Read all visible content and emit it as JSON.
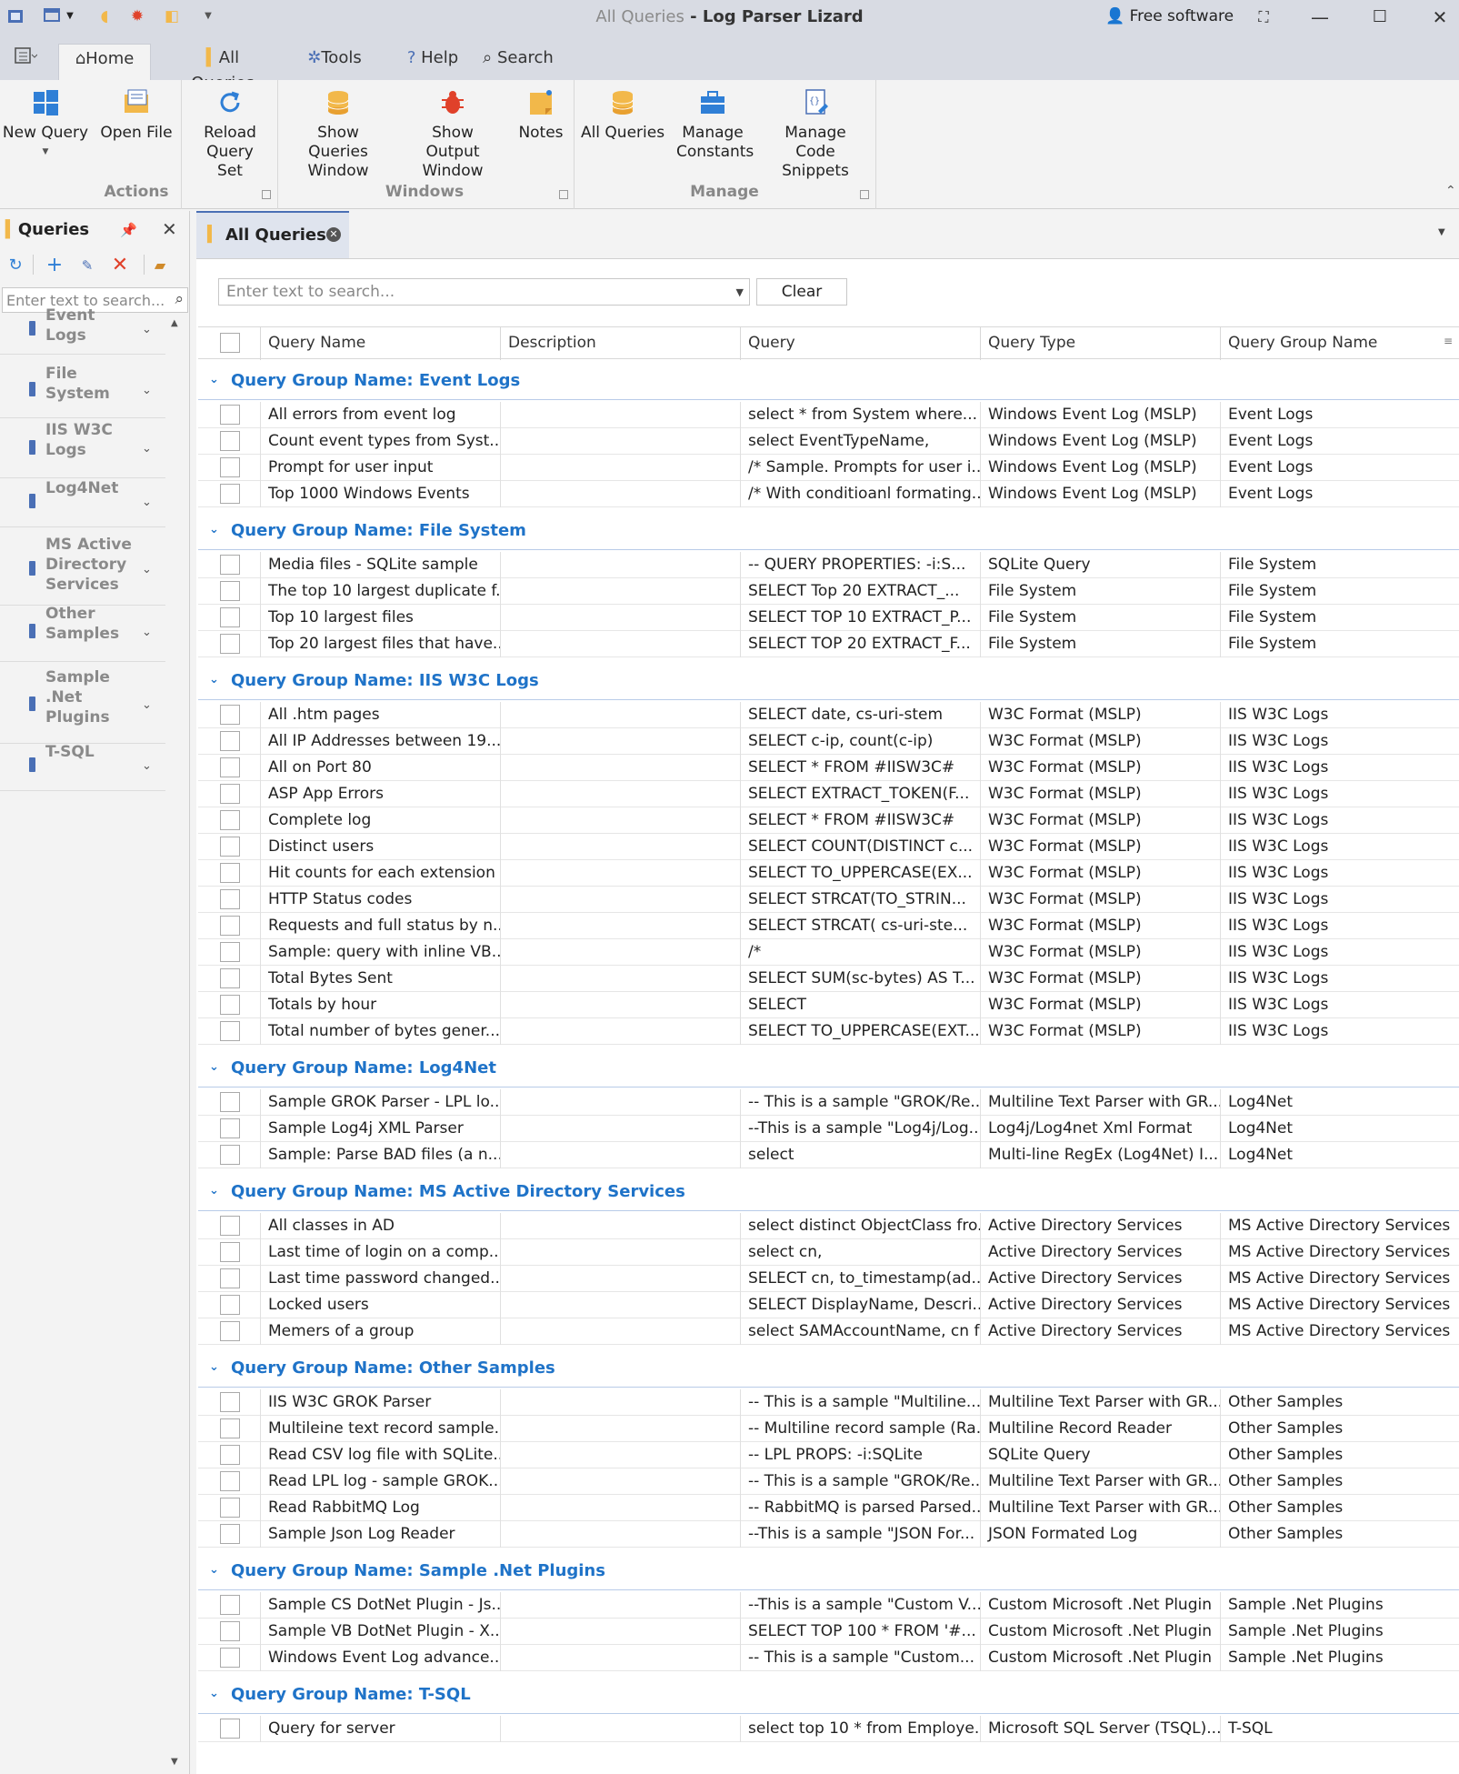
{
  "window": {
    "title_query": "All Queries",
    "title_sep": " - ",
    "title_app": "Log Parser Lizard",
    "free_software": "Free software"
  },
  "menu": {
    "tabs": [
      "Home",
      "All Queries",
      "Tools",
      "Help",
      "Search"
    ]
  },
  "ribbon": {
    "buttons": {
      "new_query": "New Query",
      "open_file": "Open File",
      "reload_query_set": "Reload Query Set",
      "show_queries_window": "Show Queries Window",
      "show_output_window": "Show Output Window",
      "notes": "Notes",
      "all_queries": "All Queries",
      "manage_constants": "Manage Constants",
      "manage_code_snippets": "Manage Code Snippets"
    },
    "groups": {
      "actions": "Actions",
      "windows": "Windows",
      "manage": "Manage"
    }
  },
  "queries_panel": {
    "title": "Queries",
    "search_placeholder": "Enter text to search...",
    "groups": [
      "Event Logs",
      "File System",
      "IIS W3C Logs",
      "Log4Net",
      "MS Active Directory Services",
      "Other Samples",
      "Sample .Net Plugins",
      "T-SQL"
    ]
  },
  "document_tab": {
    "label": "All Queries"
  },
  "grid": {
    "search_placeholder": "Enter text to search...",
    "clear_label": "Clear",
    "columns": [
      "Query Name",
      "Description",
      "Query",
      "Query Type",
      "Query Group Name"
    ],
    "group_prefix": "Query Group Name: ",
    "groups": [
      {
        "name": "Event Logs",
        "rows": [
          [
            "All errors from event log",
            "",
            "select * from System where...",
            "Windows Event Log (MSLP)",
            "Event Logs"
          ],
          [
            "Count event types from Syst...",
            "",
            "select EventTypeName,",
            "Windows Event Log (MSLP)",
            "Event Logs"
          ],
          [
            "Prompt for user input",
            "",
            "/* Sample. Prompts for user i...",
            "Windows Event Log (MSLP)",
            "Event Logs"
          ],
          [
            "Top 1000 Windows Events",
            "",
            "/* With conditioanl formating...",
            "Windows Event Log (MSLP)",
            "Event Logs"
          ]
        ]
      },
      {
        "name": "File System",
        "rows": [
          [
            "Media files - SQLite sample",
            "",
            "-- QUERY PROPERTIES: -i:S...",
            "SQLite Query",
            "File System"
          ],
          [
            "The top 10 largest duplicate f...",
            "",
            "SELECT Top 20   EXTRACT_...",
            "File System",
            "File System"
          ],
          [
            "Top 10 largest files",
            "",
            "SELECT TOP 10 EXTRACT_P...",
            "File System",
            "File System"
          ],
          [
            "Top 20 largest files that have...",
            "",
            "SELECT TOP 20  EXTRACT_F...",
            "File System",
            "File System"
          ]
        ]
      },
      {
        "name": "IIS W3C Logs",
        "rows": [
          [
            "All .htm pages",
            "",
            "SELECT date, cs-uri-stem",
            "W3C Format (MSLP)",
            "IIS W3C Logs"
          ],
          [
            "All IP Addresses between 19...",
            "",
            "SELECT c-ip, count(c-ip)",
            "W3C Format (MSLP)",
            "IIS W3C Logs"
          ],
          [
            "All on Port 80",
            "",
            "SELECT * FROM #IISW3C#",
            "W3C Format (MSLP)",
            "IIS W3C Logs"
          ],
          [
            "ASP App Errors",
            "",
            "SELECT  EXTRACT_TOKEN(F...",
            "W3C Format (MSLP)",
            "IIS W3C Logs"
          ],
          [
            "Complete log",
            "",
            "SELECT * FROM #IISW3C#",
            "W3C Format (MSLP)",
            "IIS W3C Logs"
          ],
          [
            "Distinct users",
            "",
            "SELECT COUNT(DISTINCT c...",
            "W3C Format (MSLP)",
            "IIS W3C Logs"
          ],
          [
            "Hit counts for each extension",
            "",
            "SELECT  TO_UPPERCASE(EX...",
            "W3C Format (MSLP)",
            "IIS W3C Logs"
          ],
          [
            "HTTP Status codes",
            "",
            "SELECT  STRCAT(TO_STRIN...",
            "W3C Format (MSLP)",
            "IIS W3C Logs"
          ],
          [
            "Requests and full status by n...",
            "",
            "SELECT  STRCAT( cs-uri-ste...",
            "W3C Format (MSLP)",
            "IIS W3C Logs"
          ],
          [
            "Sample: query with inline VB....",
            "",
            "/*",
            "W3C Format (MSLP)",
            "IIS W3C Logs"
          ],
          [
            "Total Bytes Sent",
            "",
            "SELECT SUM(sc-bytes) AS T...",
            "W3C Format (MSLP)",
            "IIS W3C Logs"
          ],
          [
            "Totals by hour",
            "",
            "SELECT",
            "W3C Format (MSLP)",
            "IIS W3C Logs"
          ],
          [
            "Total number of bytes gener...",
            "",
            "SELECT TO_UPPERCASE(EXT...",
            "W3C Format (MSLP)",
            "IIS W3C Logs"
          ]
        ]
      },
      {
        "name": "Log4Net",
        "rows": [
          [
            "Sample GROK Parser - LPL lo...",
            "",
            "-- This is a sample \"GROK/Re...",
            "Multiline Text Parser with GR...",
            "Log4Net"
          ],
          [
            "Sample Log4j XML Parser",
            "",
            "--This is a sample \"Log4j/Log...",
            "Log4j/Log4net Xml Format",
            "Log4Net"
          ],
          [
            "Sample: Parse BAD files (a n...",
            "",
            "select",
            "Multi-line RegEx (Log4Net) I...",
            "Log4Net"
          ]
        ]
      },
      {
        "name": "MS Active Directory Services",
        "rows": [
          [
            "All classes in AD",
            "",
            "select distinct ObjectClass fro...",
            "Active Directory Services",
            "MS Active Directory Services"
          ],
          [
            "Last time of login on a comp...",
            "",
            "select cn,",
            "Active Directory Services",
            "MS Active Directory Services"
          ],
          [
            "Last time password changed...",
            "",
            "SELECT cn, to_timestamp(ad...",
            "Active Directory Services",
            "MS Active Directory Services"
          ],
          [
            "Locked users",
            "",
            "SELECT DisplayName, Descri...",
            "Active Directory Services",
            "MS Active Directory Services"
          ],
          [
            "Memers of a group",
            "",
            "select SAMAccountName, cn f...",
            "Active Directory Services",
            "MS Active Directory Services"
          ]
        ]
      },
      {
        "name": "Other Samples",
        "rows": [
          [
            "IIS W3C GROK Parser",
            "",
            "-- This is a sample \"Multiline...",
            "Multiline Text Parser with GR...",
            "Other Samples"
          ],
          [
            "Multileine text record sample...",
            "",
            "-- Multiline record sample (Ra...",
            "Multiline Record Reader",
            "Other Samples"
          ],
          [
            "Read CSV log file with SQLite...",
            "",
            "-- LPL PROPS: -i:SQLite",
            "SQLite Query",
            "Other Samples"
          ],
          [
            "Read LPL log - sample GROK...",
            "",
            "-- This is a sample \"GROK/Re...",
            "Multiline Text Parser with GR...",
            "Other Samples"
          ],
          [
            "Read RabbitMQ Log",
            "",
            "-- RabbitMQ is parsed Parsed...",
            "Multiline Text Parser with GR...",
            "Other Samples"
          ],
          [
            "Sample Json Log Reader",
            "",
            "--This is a sample \"JSON For...",
            "JSON Formated Log",
            "Other Samples"
          ]
        ]
      },
      {
        "name": "Sample .Net Plugins",
        "rows": [
          [
            "Sample CS DotNet Plugin - Js...",
            "",
            "--This is a sample \"Custom V...",
            "Custom Microsoft .Net Plugin",
            "Sample .Net Plugins"
          ],
          [
            "Sample VB DotNet Plugin - X...",
            "",
            "SELECT TOP 100 * FROM '#...",
            "Custom Microsoft .Net Plugin",
            "Sample .Net Plugins"
          ],
          [
            "Windows Event Log advance...",
            "",
            "-- This is a sample \"Custom...",
            "Custom Microsoft .Net Plugin",
            "Sample .Net Plugins"
          ]
        ]
      },
      {
        "name": "T-SQL",
        "rows": [
          [
            "Query for server",
            "",
            "select top 10 * from Employe...",
            "Microsoft SQL Server (TSQL)...",
            "T-SQL"
          ]
        ]
      }
    ]
  },
  "colors": {
    "accent": "#1f73c8",
    "titlebar": "#d8dbe3",
    "ribbon_bg": "#f3f3f3",
    "icon_blue": "#4a6fb5",
    "icon_gold": "#f2b84a",
    "icon_red": "#e0412a"
  }
}
